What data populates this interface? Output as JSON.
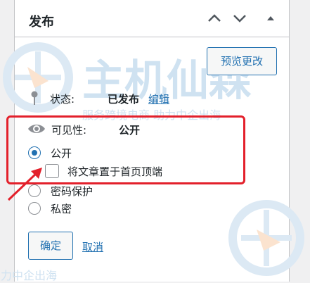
{
  "header": {
    "title": "发布"
  },
  "watermark": {
    "brand": "主机仙森",
    "slogan": "服务跨境电商 助力中企出海",
    "slogan_short": "力中企出海"
  },
  "preview_button": "预览更改",
  "status": {
    "label": "状态:",
    "value": "已发布",
    "edit_link": "编辑"
  },
  "visibility": {
    "label": "可见性:",
    "value": "公开",
    "options": [
      {
        "label": "公开",
        "checked": true
      },
      {
        "label": "密码保护",
        "checked": false
      },
      {
        "label": "私密",
        "checked": false
      }
    ],
    "sticky_label": "将文章置于首页顶端",
    "sticky_checked": false
  },
  "actions": {
    "ok": "确定",
    "cancel": "取消"
  },
  "colors": {
    "accent": "#2271b1",
    "highlight": "#e3202b",
    "text": "#1d2327"
  },
  "icons": [
    "chevron-up-icon",
    "chevron-down-icon",
    "triangle-up-icon",
    "pin-icon",
    "eye-icon"
  ]
}
